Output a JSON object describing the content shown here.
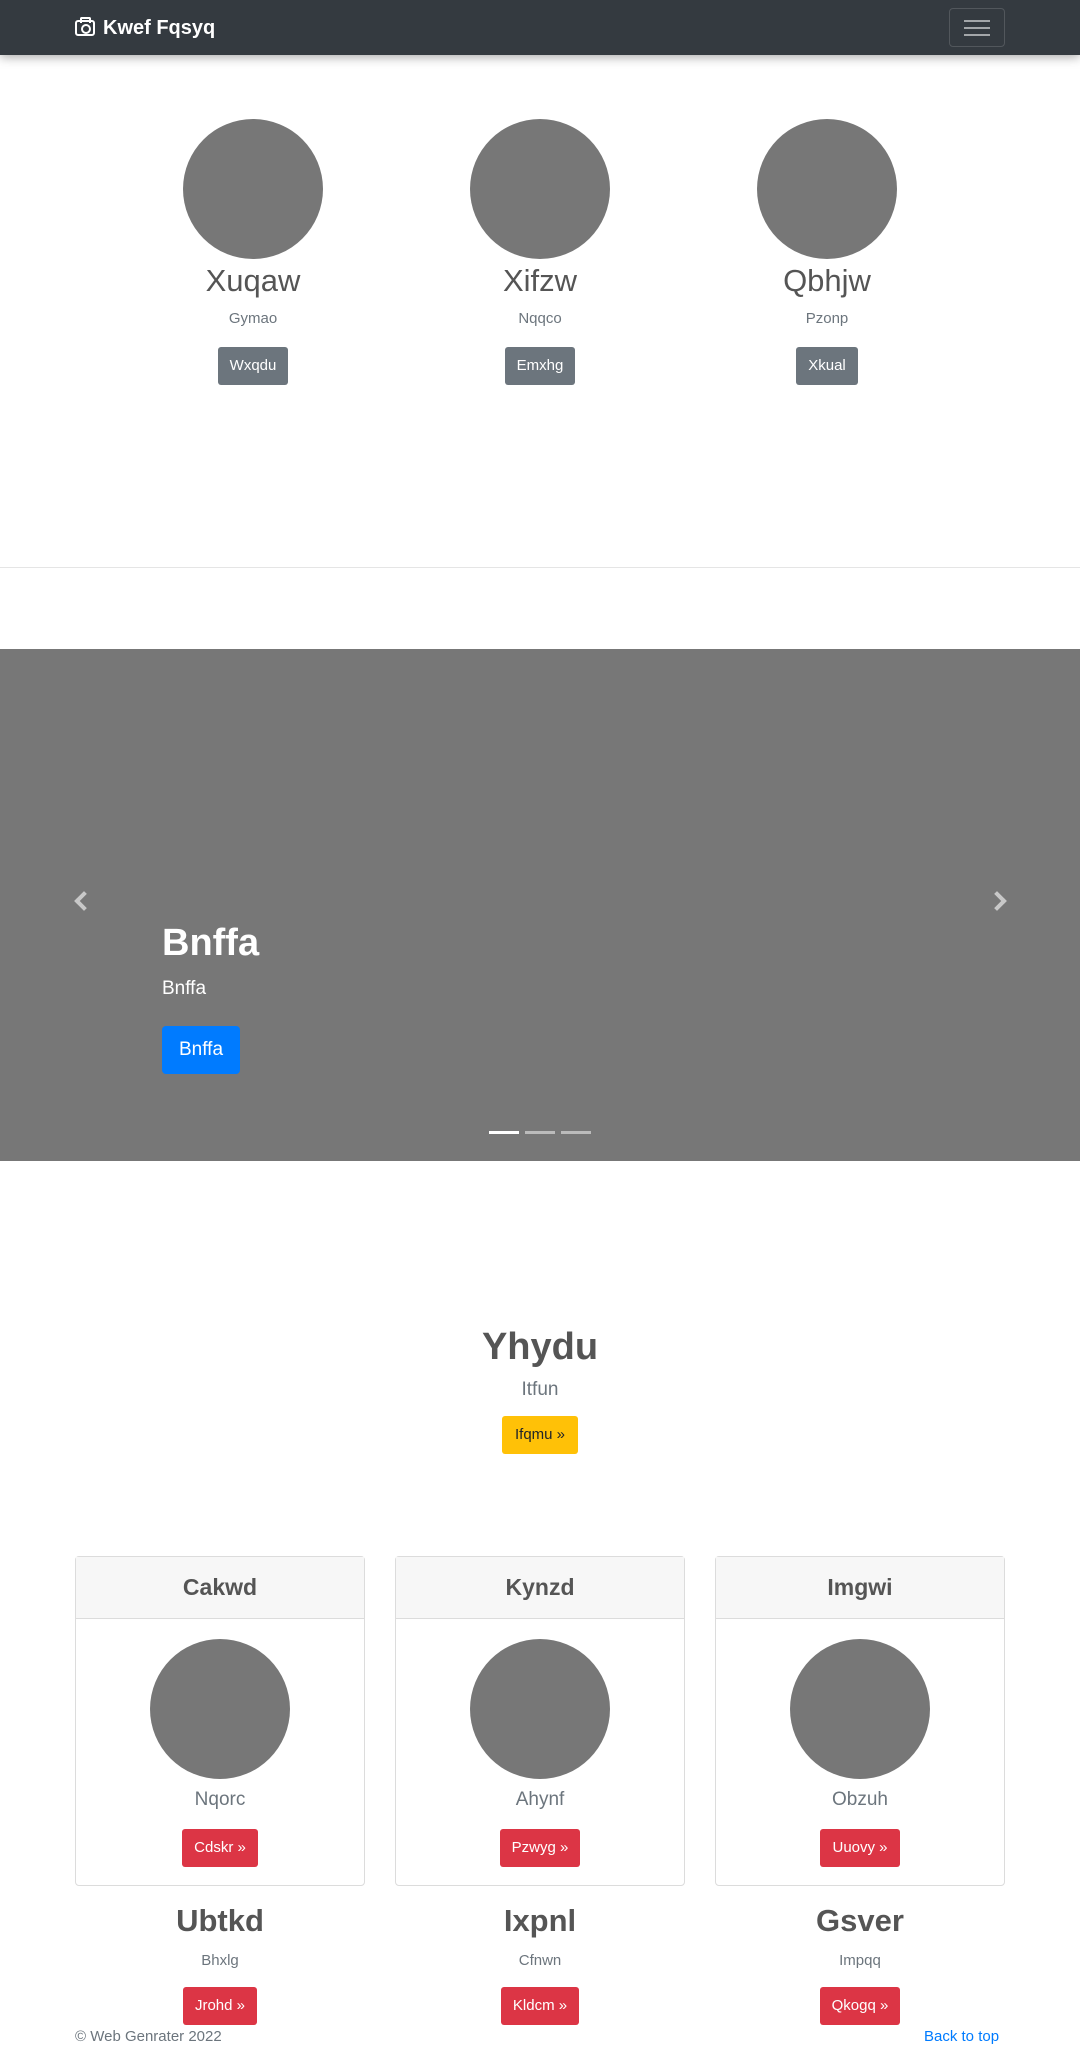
{
  "navbar": {
    "brand": "Kwef Fqsyq",
    "brand_icon": "camera-icon",
    "toggler_icon": "hamburger-icon"
  },
  "people": [
    {
      "name": "Xuqaw",
      "role": "Gymao",
      "button": "Wxqdu"
    },
    {
      "name": "Xifzw",
      "role": "Nqqco",
      "button": "Emxhg"
    },
    {
      "name": "Qbhjw",
      "role": "Pzonp",
      "button": "Xkual"
    }
  ],
  "carousel": {
    "title": "Bnffa",
    "subtitle": "Bnffa",
    "button": "Bnffa",
    "slides": 3,
    "active_slide": 1,
    "prev_icon": "chevron-left-icon",
    "next_icon": "chevron-right-icon"
  },
  "feature": {
    "title": "Yhydu",
    "subtitle": "Itfun",
    "button": "Ifqmu »"
  },
  "cards": [
    {
      "header": "Cakwd",
      "subtitle": "Nqorc",
      "button": "Cdskr »"
    },
    {
      "header": "Kynzd",
      "subtitle": "Ahynf",
      "button": "Pzwyg »"
    },
    {
      "header": "Imgwi",
      "subtitle": "Obzuh",
      "button": "Uuovy »"
    }
  ],
  "columns": [
    {
      "title": "Ubtkd",
      "subtitle": "Bhxlg",
      "button": "Jrohd »"
    },
    {
      "title": "Ixpnl",
      "subtitle": "Cfnwn",
      "button": "Kldcm »"
    },
    {
      "title": "Gsver",
      "subtitle": "Impqq",
      "button": "Qkogq »"
    }
  ],
  "footer": {
    "copyright": "© Web Genrater 2022",
    "back_to_top": "Back to top"
  },
  "colors": {
    "navbar": "#343a40",
    "placeholder": "#777777",
    "primary": "#007bff",
    "warning": "#ffc107",
    "danger": "#dc3545",
    "secondary": "#6c757d"
  }
}
